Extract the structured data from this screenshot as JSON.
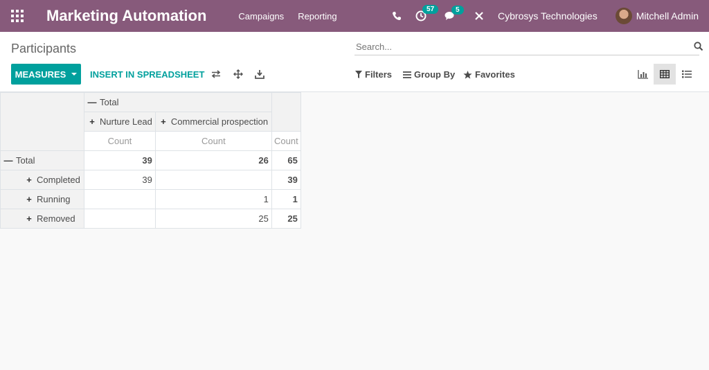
{
  "navbar": {
    "app_title": "Marketing Automation",
    "menu": [
      "Campaigns",
      "Reporting"
    ],
    "activity_count": "57",
    "messages_count": "5",
    "company": "Cybrosys Technologies",
    "user": "Mitchell Admin",
    "brand_color": "#875a7b"
  },
  "control_panel": {
    "breadcrumb": "Participants",
    "search_placeholder": "Search...",
    "measures_label": "MEASURES",
    "insert_label": "INSERT IN SPREADSHEET",
    "filters_label": "Filters",
    "group_by_label": "Group By",
    "favorites_label": "Favorites",
    "accent_color": "#00a09d"
  },
  "pivot": {
    "col_total_label": "Total",
    "col_groups": [
      "Nurture Lead",
      "Commercial prospection"
    ],
    "measure_label": "Count",
    "rows": [
      {
        "label": "Total",
        "values": [
          "39",
          "26",
          "65"
        ]
      },
      {
        "label": "Completed",
        "values": [
          "39",
          "",
          "39"
        ]
      },
      {
        "label": "Running",
        "values": [
          "",
          "1",
          "1"
        ]
      },
      {
        "label": "Removed",
        "values": [
          "",
          "25",
          "25"
        ]
      }
    ]
  }
}
